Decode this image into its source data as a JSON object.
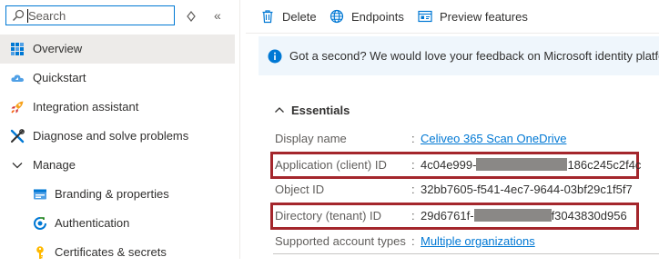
{
  "search": {
    "placeholder": "Search",
    "value": ""
  },
  "sidebar": {
    "items": [
      {
        "label": "Overview",
        "icon": "overview-grid-icon",
        "selected": true
      },
      {
        "label": "Quickstart",
        "icon": "cloud-icon"
      },
      {
        "label": "Integration assistant",
        "icon": "rocket-icon"
      },
      {
        "label": "Diagnose and solve problems",
        "icon": "wrench-icon"
      },
      {
        "label": "Manage",
        "icon": "chevron-down-icon"
      },
      {
        "label": "Branding & properties",
        "icon": "branding-card-icon"
      },
      {
        "label": "Authentication",
        "icon": "authentication-icon"
      },
      {
        "label": "Certificates & secrets",
        "icon": "key-icon"
      }
    ]
  },
  "toolbar": {
    "delete_label": "Delete",
    "endpoints_label": "Endpoints",
    "preview_label": "Preview features"
  },
  "banner": {
    "message": "Got a second? We would love your feedback on Microsoft identity platform (p"
  },
  "essentials": {
    "title": "Essentials",
    "rows": [
      {
        "key": "Display name",
        "sep": ":",
        "value": "Celiveo 365 Scan OneDrive",
        "link": true
      },
      {
        "key": "Application (client) ID",
        "sep": ":",
        "value_start": "4c04e999-",
        "value_end": "186c245c2f4c",
        "redacted": true
      },
      {
        "key": "Object ID",
        "sep": ":",
        "value": "32bb7605-f541-4ec7-9644-03bf29c1f5f7"
      },
      {
        "key": "Directory (tenant) ID",
        "sep": ":",
        "value_start": "29d6761f-",
        "value_end": "f3043830d956",
        "redacted": true
      },
      {
        "key": "Supported account types",
        "sep": ":",
        "value": "Multiple organizations",
        "link": true
      }
    ]
  },
  "colors": {
    "accent": "#0078d4",
    "highlight_border": "#a4262c",
    "selected_bg": "#edebe9",
    "banner_bg": "#eff6fc",
    "redaction": "#8a8886"
  }
}
